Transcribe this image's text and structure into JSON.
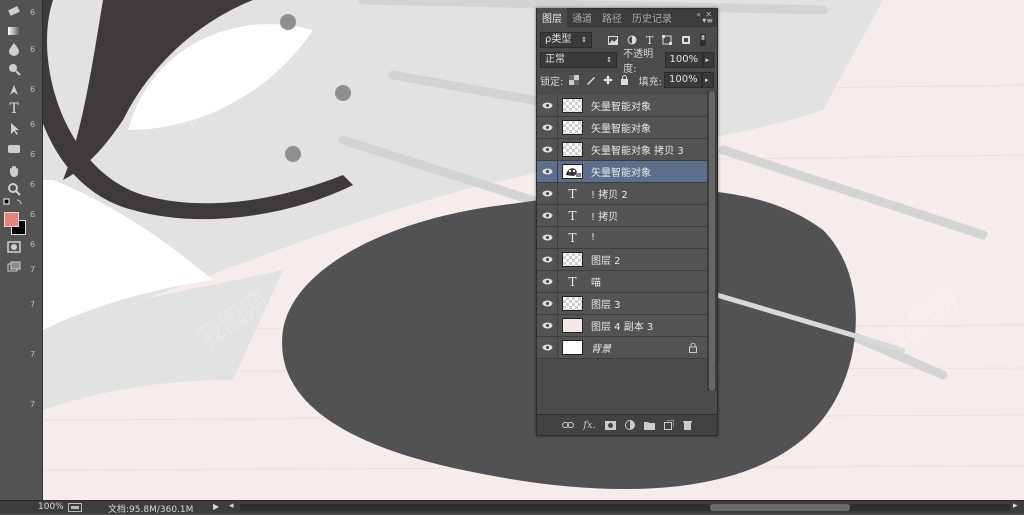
{
  "colors": {
    "foreground": "#e8837a",
    "background": "#000000",
    "accent": "#5d6f8c"
  },
  "toolbar": {
    "tools": [
      "eraser-icon",
      "gradient-icon",
      "blur-icon",
      "dodge-icon",
      "pen-icon",
      "type-icon",
      "path-selection-icon",
      "rectangle-icon",
      "hand-icon",
      "zoom-icon"
    ],
    "type_tool_glyph": "T"
  },
  "ruler": {
    "ticks": [
      "6",
      "6",
      "6",
      "6",
      "6",
      "6",
      "6",
      "6",
      "7",
      "7",
      "7",
      "7"
    ]
  },
  "panel": {
    "tabs": [
      "图层",
      "通道",
      "路径",
      "历史记录"
    ],
    "active_tab": 0,
    "filter_kind": "ρ类型",
    "blend_mode": "正常",
    "opacity_label": "不透明度:",
    "opacity_value": "100%",
    "lock_label": "锁定:",
    "fill_label": "填充:",
    "fill_value": "100%",
    "layers": [
      {
        "name": "矢量智能对象",
        "type": "checker",
        "selected": false
      },
      {
        "name": "矢量智能对象",
        "type": "checker",
        "selected": false
      },
      {
        "name": "矢量智能对象 拷贝 3",
        "type": "checker",
        "selected": false
      },
      {
        "name": "矢量智能对象",
        "type": "smart",
        "selected": true
      },
      {
        "name": "! 拷贝 2",
        "type": "text",
        "selected": false
      },
      {
        "name": "! 拷贝",
        "type": "text",
        "selected": false
      },
      {
        "name": "!",
        "type": "text",
        "selected": false
      },
      {
        "name": "图层 2",
        "type": "checker",
        "selected": false
      },
      {
        "name": "喵",
        "type": "text",
        "selected": false
      },
      {
        "name": "图层 3",
        "type": "checker",
        "selected": false
      },
      {
        "name": "图层 4 副本 3",
        "type": "pink",
        "selected": false
      },
      {
        "name": "背景",
        "type": "white",
        "selected": false,
        "locked": true,
        "italic": true
      }
    ],
    "footer_icons": [
      "link-icon",
      "fx-icon",
      "mask-icon",
      "adjustment-icon",
      "group-icon",
      "new-layer-icon",
      "trash-icon"
    ],
    "fx_label": "fx."
  },
  "statusbar": {
    "zoom": "100%",
    "doc_info": "文档:95.8M/360.1M"
  }
}
